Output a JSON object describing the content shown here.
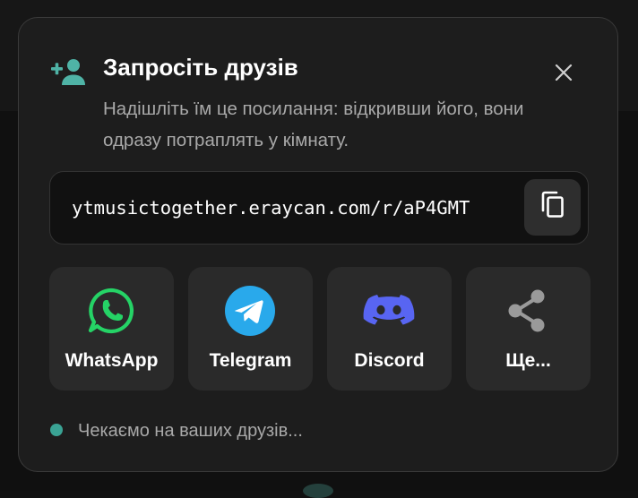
{
  "dialog": {
    "title": "Запросіть друзів",
    "subtitle": "Надішліть їм це посилання: відкривши його, вони одразу потраплять у кімнату.",
    "header_icon": "add-person-icon",
    "close_icon": "close-icon"
  },
  "invite_link": {
    "url": "ytmusictogether.eraycan.com/r/aP4GMT",
    "copy_icon": "copy-icon"
  },
  "share_options": [
    {
      "label": "WhatsApp",
      "icon": "whatsapp-icon",
      "color": "#25d366"
    },
    {
      "label": "Telegram",
      "icon": "telegram-icon",
      "color": "#29a9eb"
    },
    {
      "label": "Discord",
      "icon": "discord-icon",
      "color": "#5865f2"
    },
    {
      "label": "Ще...",
      "icon": "share-icon",
      "color": "#9a9a9a"
    }
  ],
  "status": {
    "text": "Чекаємо на ваших друзів...",
    "dot_color": "#3aa394"
  },
  "colors": {
    "accent": "#4fb3a6",
    "background": "#1d1d1d",
    "tile": "#2a2a2a"
  }
}
